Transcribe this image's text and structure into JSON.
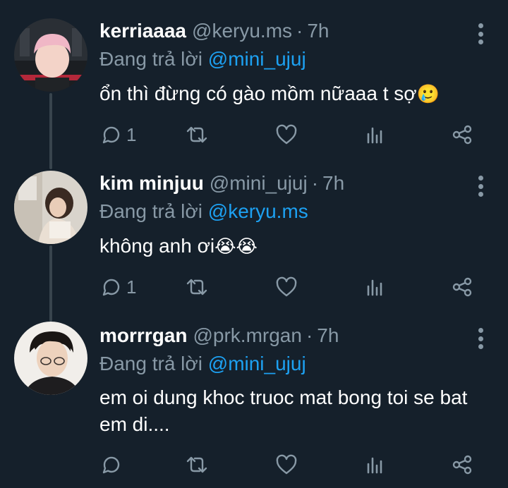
{
  "colors": {
    "background": "#15202b",
    "secondary_text": "#8899a6",
    "mention": "#1da1f2",
    "thread_line": "#38444d"
  },
  "tweets": [
    {
      "name": "kerriaaaa",
      "handle": "@keryu.ms",
      "separator": "·",
      "time": "7h",
      "replying_prefix": "Đang trả lời ",
      "replying_to": "@mini_ujuj",
      "text": "ổn thì đừng có gào mồm nữaaa t sợ",
      "emoji": "🥲",
      "reply_count": "1"
    },
    {
      "name": "kim minjuu",
      "handle": "@mini_ujuj",
      "separator": "·",
      "time": "7h",
      "replying_prefix": "Đang trả lời ",
      "replying_to": "@keryu.ms",
      "text": "không anh ơi",
      "emoji": "😭😭",
      "reply_count": "1"
    },
    {
      "name": "morrrgan",
      "handle": "@prk.mrgan",
      "separator": "·",
      "time": "7h",
      "replying_prefix": "Đang trả lời ",
      "replying_to": "@mini_ujuj",
      "text": "em oi dung khoc truoc mat bong toi se bat em di....",
      "emoji": "",
      "reply_count": ""
    }
  ],
  "icons": {
    "reply": "reply-icon",
    "retweet": "retweet-icon",
    "like": "heart-icon",
    "analytics": "analytics-icon",
    "share": "share-icon",
    "more": "more-vertical-icon"
  }
}
